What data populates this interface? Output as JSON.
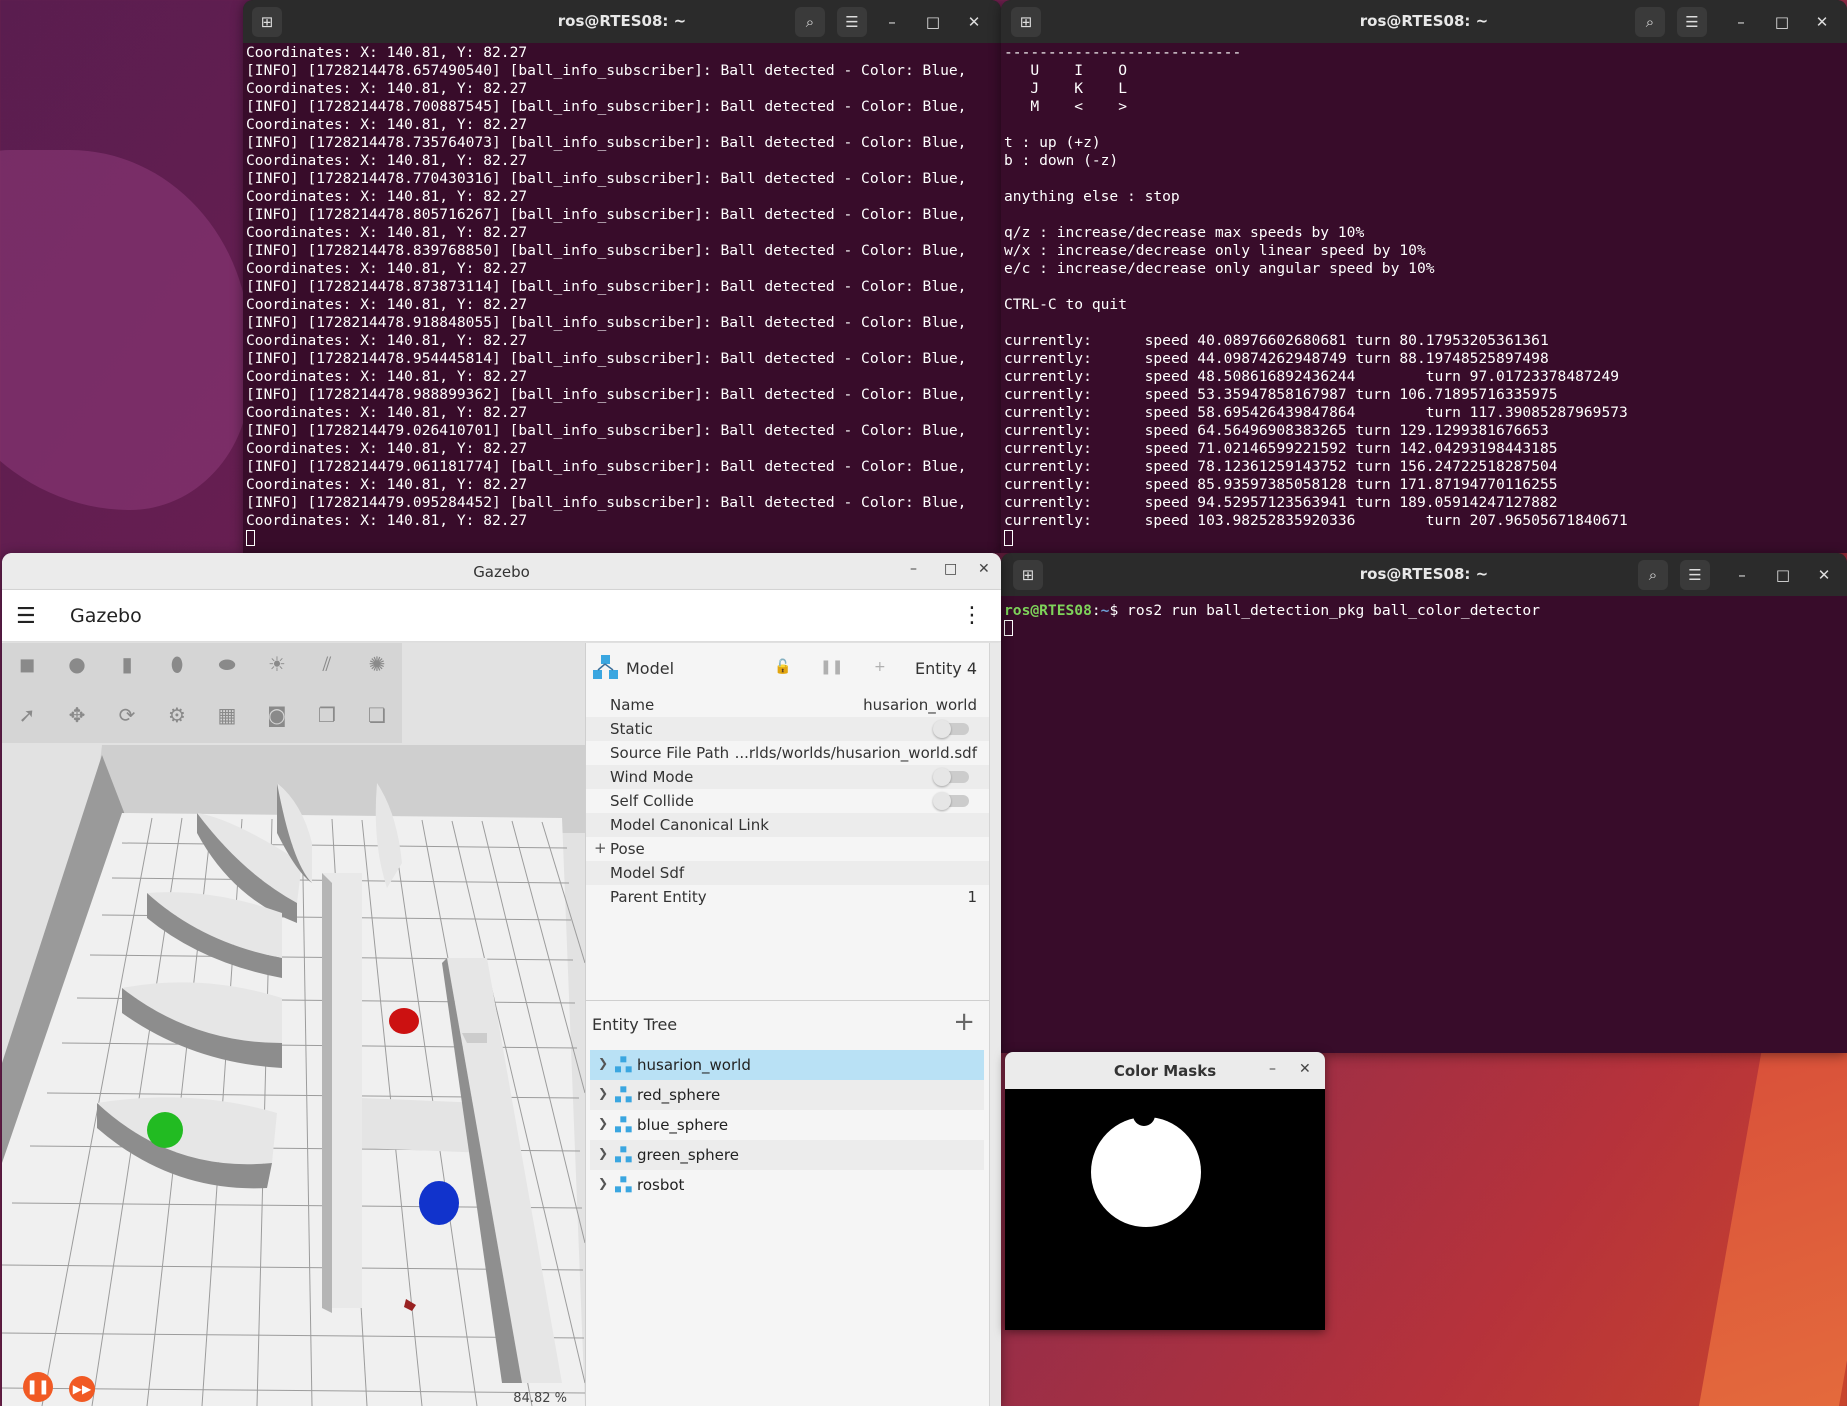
{
  "desktop": {},
  "term_left": {
    "title": "ros@RTES08: ~",
    "lines": [
      "Coordinates: X: 140.81, Y: 82.27",
      "[INFO] [1728214478.657490540] [ball_info_subscriber]: Ball detected - Color: Blue,",
      "Coordinates: X: 140.81, Y: 82.27",
      "[INFO] [1728214478.700887545] [ball_info_subscriber]: Ball detected - Color: Blue,",
      "Coordinates: X: 140.81, Y: 82.27",
      "[INFO] [1728214478.735764073] [ball_info_subscriber]: Ball detected - Color: Blue,",
      "Coordinates: X: 140.81, Y: 82.27",
      "[INFO] [1728214478.770430316] [ball_info_subscriber]: Ball detected - Color: Blue,",
      "Coordinates: X: 140.81, Y: 82.27",
      "[INFO] [1728214478.805716267] [ball_info_subscriber]: Ball detected - Color: Blue,",
      "Coordinates: X: 140.81, Y: 82.27",
      "[INFO] [1728214478.839768850] [ball_info_subscriber]: Ball detected - Color: Blue,",
      "Coordinates: X: 140.81, Y: 82.27",
      "[INFO] [1728214478.873873114] [ball_info_subscriber]: Ball detected - Color: Blue,",
      "Coordinates: X: 140.81, Y: 82.27",
      "[INFO] [1728214478.918848055] [ball_info_subscriber]: Ball detected - Color: Blue,",
      "Coordinates: X: 140.81, Y: 82.27",
      "[INFO] [1728214478.954445814] [ball_info_subscriber]: Ball detected - Color: Blue,",
      "Coordinates: X: 140.81, Y: 82.27",
      "[INFO] [1728214478.988899362] [ball_info_subscriber]: Ball detected - Color: Blue,",
      "Coordinates: X: 140.81, Y: 82.27",
      "[INFO] [1728214479.026410701] [ball_info_subscriber]: Ball detected - Color: Blue,",
      "Coordinates: X: 140.81, Y: 82.27",
      "[INFO] [1728214479.061181774] [ball_info_subscriber]: Ball detected - Color: Blue,",
      "Coordinates: X: 140.81, Y: 82.27",
      "[INFO] [1728214479.095284452] [ball_info_subscriber]: Ball detected - Color: Blue,",
      "Coordinates: X: 140.81, Y: 82.27"
    ]
  },
  "term_right": {
    "title": "ros@RTES08: ~",
    "lines": [
      "---------------------------",
      "   U    I    O",
      "   J    K    L",
      "   M    <    >",
      "",
      "t : up (+z)",
      "b : down (-z)",
      "",
      "anything else : stop",
      "",
      "q/z : increase/decrease max speeds by 10%",
      "w/x : increase/decrease only linear speed by 10%",
      "e/c : increase/decrease only angular speed by 10%",
      "",
      "CTRL-C to quit",
      "",
      "currently:\tspeed 40.08976602680681 turn 80.17953205361361",
      "currently:\tspeed 44.09874262948749 turn 88.19748525897498",
      "currently:\tspeed 48.508616892436244\tturn 97.01723378487249",
      "currently:\tspeed 53.35947858167987 turn 106.71895716335975",
      "currently:\tspeed 58.695426439847864\tturn 117.39085287969573",
      "currently:\tspeed 64.56496908383265 turn 129.1299381676653",
      "currently:\tspeed 71.02146599221592 turn 142.04293198443185",
      "currently:\tspeed 78.12361259143752 turn 156.24722518287504",
      "currently:\tspeed 85.93597385058128 turn 171.87194770116255",
      "currently:\tspeed 94.52957123563941 turn 189.05914247127882",
      "currently:\tspeed 103.98252835920336\tturn 207.96505671840671"
    ]
  },
  "term_bottom": {
    "title": "ros@RTES08: ~",
    "prompt_user": "ros@RTES08",
    "prompt_sep": ":",
    "prompt_path": "~",
    "prompt_dollar": "$ ",
    "command": "ros2 run ball_detection_pkg ball_color_detector"
  },
  "gazebo": {
    "window_title": "Gazebo",
    "app_title": "Gazebo",
    "rtf": "84.82 %",
    "component_inspector": {
      "type_label": "Model",
      "entity_label": "Entity 4",
      "properties": [
        {
          "label": "Name",
          "value": "husarion_world",
          "kind": "text"
        },
        {
          "label": "Static",
          "value": "",
          "kind": "toggle"
        },
        {
          "label": "Source File Path",
          "value": "...rlds/worlds/husarion_world.sdf",
          "kind": "text"
        },
        {
          "label": "Wind Mode",
          "value": "",
          "kind": "toggle"
        },
        {
          "label": "Self Collide",
          "value": "",
          "kind": "toggle"
        },
        {
          "label": "Model Canonical Link",
          "value": "",
          "kind": "text"
        },
        {
          "label": "Pose",
          "value": "",
          "kind": "expand"
        },
        {
          "label": "Model Sdf",
          "value": "",
          "kind": "text"
        },
        {
          "label": "Parent Entity",
          "value": "1",
          "kind": "text"
        }
      ]
    },
    "entity_tree": {
      "title": "Entity Tree",
      "items": [
        "husarion_world",
        "red_sphere",
        "blue_sphere",
        "green_sphere",
        "rosbot"
      ],
      "selected_index": 0
    },
    "colors": {
      "accent": "#f15a24",
      "selection": "#b9e1f5"
    }
  },
  "color_masks": {
    "title": "Color Masks"
  }
}
